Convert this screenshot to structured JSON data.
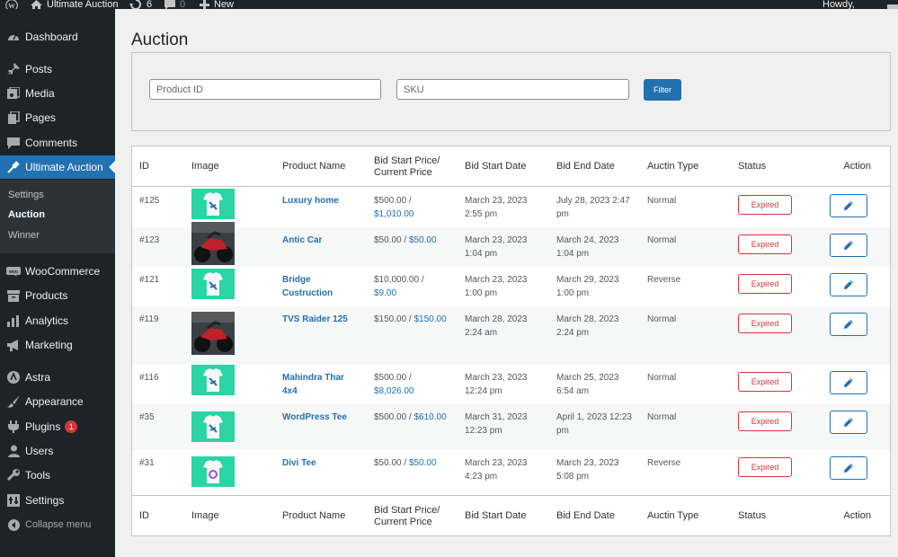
{
  "adminbar": {
    "site_name": "Ultimate Auction",
    "updates_count": "6",
    "comments_count": "0",
    "new_label": "New",
    "greeting": "Howdy, admin"
  },
  "sidebar": {
    "items": [
      {
        "label": "Dashboard",
        "icon": "dashboard-icon"
      },
      {
        "label": "Posts",
        "icon": "pin-icon"
      },
      {
        "label": "Media",
        "icon": "media-icon"
      },
      {
        "label": "Pages",
        "icon": "pages-icon"
      },
      {
        "label": "Comments",
        "icon": "comment-icon"
      },
      {
        "label": "Ultimate Auction",
        "icon": "hammer-icon"
      },
      {
        "label": "WooCommerce",
        "icon": "woo-icon"
      },
      {
        "label": "Products",
        "icon": "archive-icon"
      },
      {
        "label": "Analytics",
        "icon": "bar-chart-icon"
      },
      {
        "label": "Marketing",
        "icon": "megaphone-icon"
      },
      {
        "label": "Astra",
        "icon": "astra-icon"
      },
      {
        "label": "Appearance",
        "icon": "brush-icon"
      },
      {
        "label": "Plugins",
        "icon": "plugin-icon",
        "badge": "1"
      },
      {
        "label": "Users",
        "icon": "user-icon"
      },
      {
        "label": "Tools",
        "icon": "wrench-icon"
      },
      {
        "label": "Settings",
        "icon": "settings-icon"
      }
    ],
    "submenu": [
      "Settings",
      "Auction",
      "Winner"
    ],
    "collapse_label": "Collapse menu"
  },
  "page": {
    "title": "Auction",
    "filter": {
      "product_id_placeholder": "Product ID",
      "sku_placeholder": "SKU",
      "button_label": "Filter"
    }
  },
  "table": {
    "headers": {
      "id": "ID",
      "image": "Image",
      "product_name": "Product Name",
      "price_line1": "Bid Start Price/",
      "price_line2": "Current Price",
      "start": "Bid Start Date",
      "end": "Bid End Date",
      "type": "Auctin Type",
      "status": "Status",
      "action": "Action"
    },
    "rows": [
      {
        "id": "#125",
        "image": "tshirt-thumb",
        "name1": "Luxury home",
        "name2": "",
        "price_start": "$500.00 /",
        "price_current": "$1,010.00",
        "start1": "March 23, 2023",
        "start2": "2:55 pm",
        "end1": "July 28, 2023 2:47",
        "end2": "pm",
        "type": "Normal",
        "status": "Expired"
      },
      {
        "id": "#123",
        "image": "motorbike-thumb",
        "name1": "Antic Car",
        "name2": "",
        "price_start": "$50.00 /",
        "price_current": "$50.00",
        "start1": "March 23, 2023",
        "start2": "1:04 pm",
        "end1": "March 24, 2023",
        "end2": "1:04 pm",
        "type": "Normal",
        "status": "Expired"
      },
      {
        "id": "#121",
        "image": "tshirt-thumb",
        "name1": "Bridge",
        "name2": "Custruction",
        "price_start": "$10,000.00 /",
        "price_current": "$9.00",
        "start1": "March 23, 2023",
        "start2": "1:00 pm",
        "end1": "March 29, 2023",
        "end2": "1:00 pm",
        "type": "Reverse",
        "status": "Expired"
      },
      {
        "id": "#119",
        "image": "motorbike-thumb",
        "name1": "TVS Raider 125",
        "name2": "",
        "price_start": "$150.00 /",
        "price_current": "$150.00",
        "start1": "March 28, 2023",
        "start2": "2:24 am",
        "end1": "March 28, 2023",
        "end2": "2:24 pm",
        "type": "Normal",
        "status": "Expired"
      },
      {
        "id": "#116",
        "image": "tshirt-thumb",
        "name1": "Mahindra Thar",
        "name2": "4x4",
        "price_start": "$500.00 /",
        "price_current": "$8,026.00",
        "start1": "March 23, 2023",
        "start2": "12:24 pm",
        "end1": "March 25, 2023",
        "end2": "6:54 am",
        "type": "Normal",
        "status": "Expired"
      },
      {
        "id": "#35",
        "image": "tshirt-thumb",
        "name1": "WordPress Tee",
        "name2": "",
        "price_start": "$500.00 /",
        "price_current": "$610.00",
        "start1": "March 31, 2023",
        "start2": "12:23 pm",
        "end1": "April 1, 2023 12:23",
        "end2": "pm",
        "type": "Normal",
        "status": "Expired"
      },
      {
        "id": "#31",
        "image": "divi-tshirt-thumb",
        "name1": "Divi Tee",
        "name2": "",
        "price_start": "$50.00 /",
        "price_current": "$50.00",
        "start1": "March 23, 2023",
        "start2": "4:23 pm",
        "end1": "March 23, 2023",
        "end2": "5:08 pm",
        "type": "Reverse",
        "status": "Expired"
      }
    ]
  },
  "colors": {
    "sidebar_bg": "#1d2327",
    "accent": "#2271b1",
    "expired": "#d63638",
    "thumb_green": "#2bd4a4"
  }
}
